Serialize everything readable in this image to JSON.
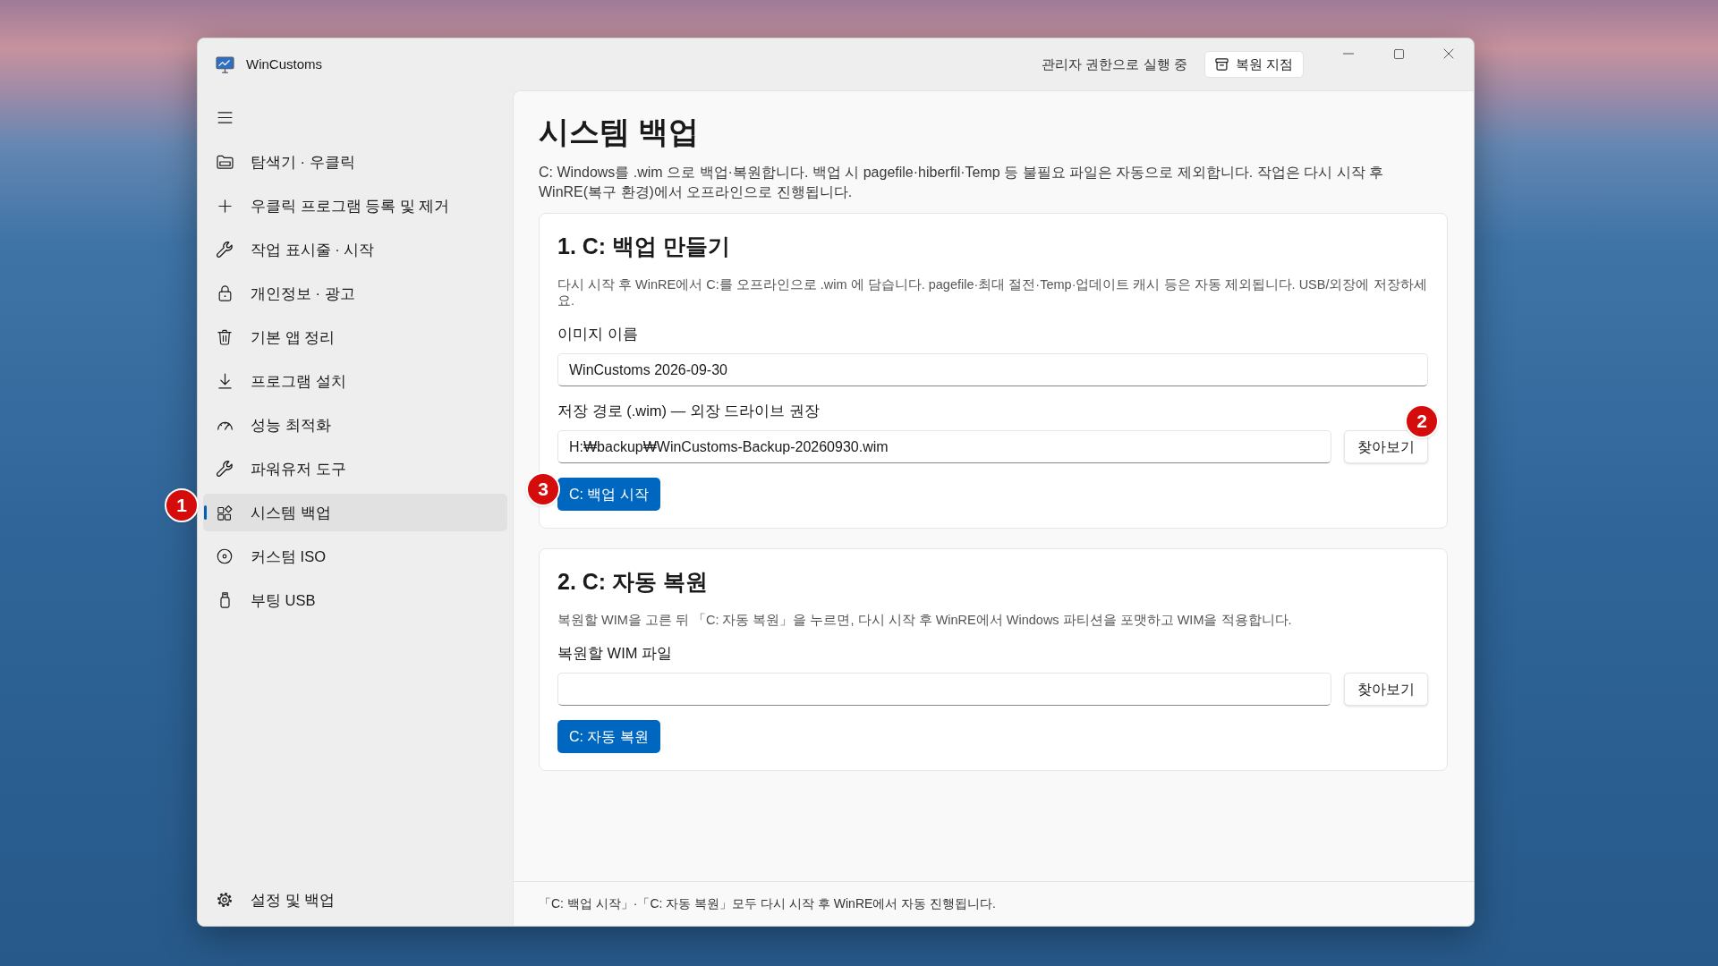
{
  "window": {
    "title": "WinCustoms",
    "status_text": "관리자 권한으로 실행 중",
    "restore_point_button": "복원 지점"
  },
  "sidebar": {
    "items": [
      {
        "label": "탐색기 · 우클릭",
        "selected": false
      },
      {
        "label": "우클릭 프로그램 등록 및 제거",
        "selected": false
      },
      {
        "label": "작업 표시줄 · 시작",
        "selected": false
      },
      {
        "label": "개인정보 · 광고",
        "selected": false
      },
      {
        "label": "기본 앱 정리",
        "selected": false
      },
      {
        "label": "프로그램 설치",
        "selected": false
      },
      {
        "label": "성능 최적화",
        "selected": false
      },
      {
        "label": "파워유저 도구",
        "selected": false
      },
      {
        "label": "시스템 백업",
        "selected": true,
        "marker": "1"
      },
      {
        "label": "커스텀 ISO",
        "selected": false
      },
      {
        "label": "부팅 USB",
        "selected": false
      }
    ],
    "footer_item": {
      "label": "설정 및 백업"
    }
  },
  "page": {
    "title": "시스템 백업",
    "description": "C: Windows를 .wim 으로 백업·복원합니다. 백업 시 pagefile·hiberfil·Temp 등 불필요 파일은 자동으로 제외합니다. 작업은 다시 시작 후 WinRE(복구 환경)에서 오프라인으로 진행됩니다."
  },
  "sections": [
    {
      "title": "1. C: 백업 만들기",
      "description": "다시 시작 후 WinRE에서 C:를 오프라인으로 .wim 에 담습니다. pagefile·최대 절전·Temp·업데이트 캐시 등은 자동 제외됩니다. USB/외장에 저장하세요.",
      "fields": [
        {
          "label": "이미지 이름",
          "value": "WinCustoms 2026-09-30"
        },
        {
          "label": "저장 경로 (.wim) — 외장 드라이브 권장",
          "value": "H:₩backup₩WinCustoms-Backup-20260930.wim",
          "browse_button": {
            "label": "찾아보기",
            "marker": "2"
          }
        }
      ],
      "action_button": {
        "label": "C: 백업 시작",
        "marker": "3"
      }
    },
    {
      "title": "2. C: 자동 복원",
      "description": "복원할 WIM을 고른 뒤 「C: 자동 복원」을 누르면, 다시 시작 후 WinRE에서 Windows 파티션을 포맷하고 WIM을 적용합니다.",
      "fields": [
        {
          "label": "복원할 WIM 파일",
          "browse_button": {
            "label": "찾아보기"
          }
        }
      ],
      "action_button": {
        "label": "C: 자동 복원"
      }
    }
  ],
  "footer": {
    "text": "「C: 백업 시작」·「C: 자동 복원」모두 다시 시작 후 WinRE에서 자동 진행됩니다."
  }
}
